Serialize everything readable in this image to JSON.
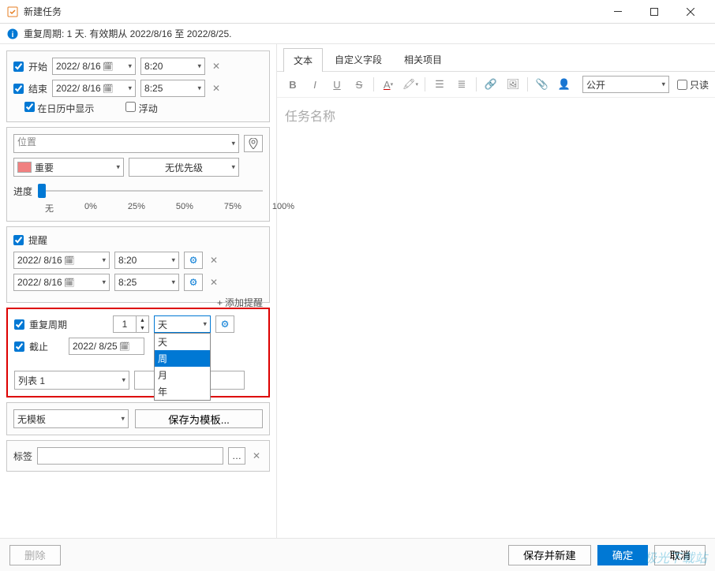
{
  "window": {
    "title": "新建任务"
  },
  "info": {
    "text": "重复周期: 1 天. 有效期从 2022/8/16 至 2022/8/25."
  },
  "schedule": {
    "start_label": "开始",
    "start_date": "2022/ 8/16",
    "start_time": "8:20",
    "end_label": "结束",
    "end_date": "2022/ 8/16",
    "end_time": "8:25",
    "show_calendar": "在日历中显示",
    "floating": "浮动"
  },
  "location": {
    "placeholder": "位置"
  },
  "importance": {
    "label": "重要"
  },
  "priority": {
    "label": "无优先级"
  },
  "progress": {
    "label": "进度",
    "ticks": [
      "无",
      "0%",
      "25%",
      "50%",
      "75%",
      "100%"
    ]
  },
  "reminder": {
    "label": "提醒",
    "r1_date": "2022/ 8/16",
    "r1_time": "8:20",
    "r2_date": "2022/ 8/16",
    "r2_time": "8:25",
    "add": "添加提醒"
  },
  "recurrence": {
    "label": "重复周期",
    "count": "1",
    "unit_selected": "天",
    "units": [
      "天",
      "周",
      "月",
      "年"
    ],
    "until_label": "截止",
    "until_date": "2022/ 8/25"
  },
  "list": {
    "label": "列表 1"
  },
  "template": {
    "none": "无模板",
    "save": "保存为模板..."
  },
  "tag": {
    "label": "标签"
  },
  "footer": {
    "delete": "删除",
    "save_new": "保存并新建",
    "ok": "确定",
    "cancel": "取消"
  },
  "tabs": {
    "t1": "文本",
    "t2": "自定义字段",
    "t3": "相关项目"
  },
  "editor": {
    "visibility": "公开",
    "readonly": "只读",
    "placeholder": "任务名称"
  },
  "watermark": "极光下载站"
}
